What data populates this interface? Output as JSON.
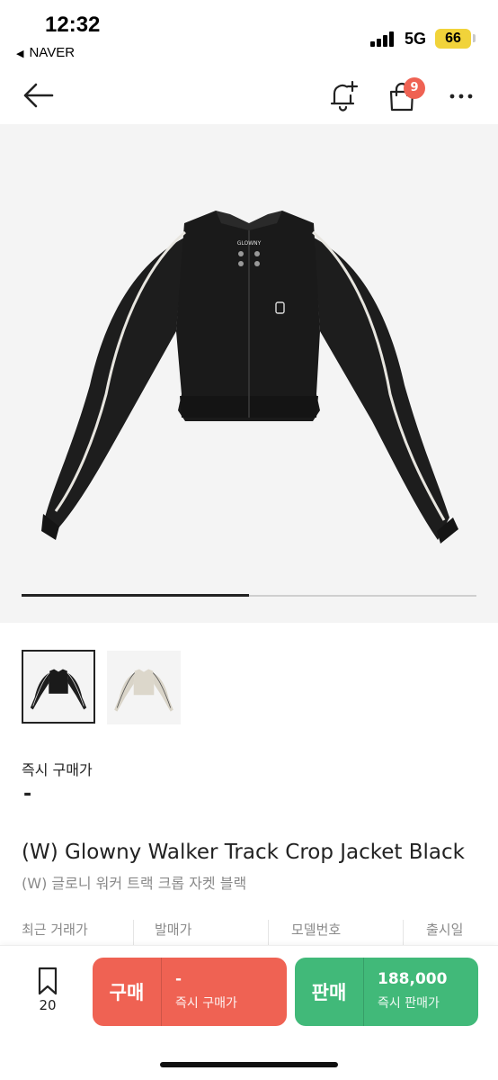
{
  "status_bar": {
    "time": "12:32",
    "back_app": "NAVER",
    "network": "5G",
    "battery": "66",
    "battery_color": "#f1d33a"
  },
  "nav": {
    "back_icon": "arrow-left-icon",
    "alert_icon": "bell-plus-icon",
    "cart_icon": "shopping-bag-icon",
    "cart_count": "9",
    "more_icon": "more-horizontal-icon"
  },
  "gallery": {
    "brand_tag": "GLOWNY",
    "progress": 0.5
  },
  "thumbnails": [
    {
      "color": "black",
      "selected": true
    },
    {
      "color": "beige",
      "selected": false
    }
  ],
  "product": {
    "instant_buy_label": "즉시 구매가",
    "instant_buy_price": "-",
    "name_en": "(W) Glowny Walker Track Crop Jacket Black",
    "name_ko": "(W) 글로니 워커 트랙 크롭 자켓 블랙"
  },
  "info": {
    "columns": [
      "최근 거래가",
      "발매가",
      "모델번호",
      "출시일"
    ]
  },
  "bottom_bar": {
    "bookmark_icon": "bookmark-icon",
    "bookmark_count": "20",
    "buy": {
      "label": "구매",
      "price": "-",
      "sub": "즉시 구매가",
      "color": "#ef6253"
    },
    "sell": {
      "label": "판매",
      "price": "188,000",
      "sub": "즉시 판매가",
      "color": "#41b979"
    }
  }
}
